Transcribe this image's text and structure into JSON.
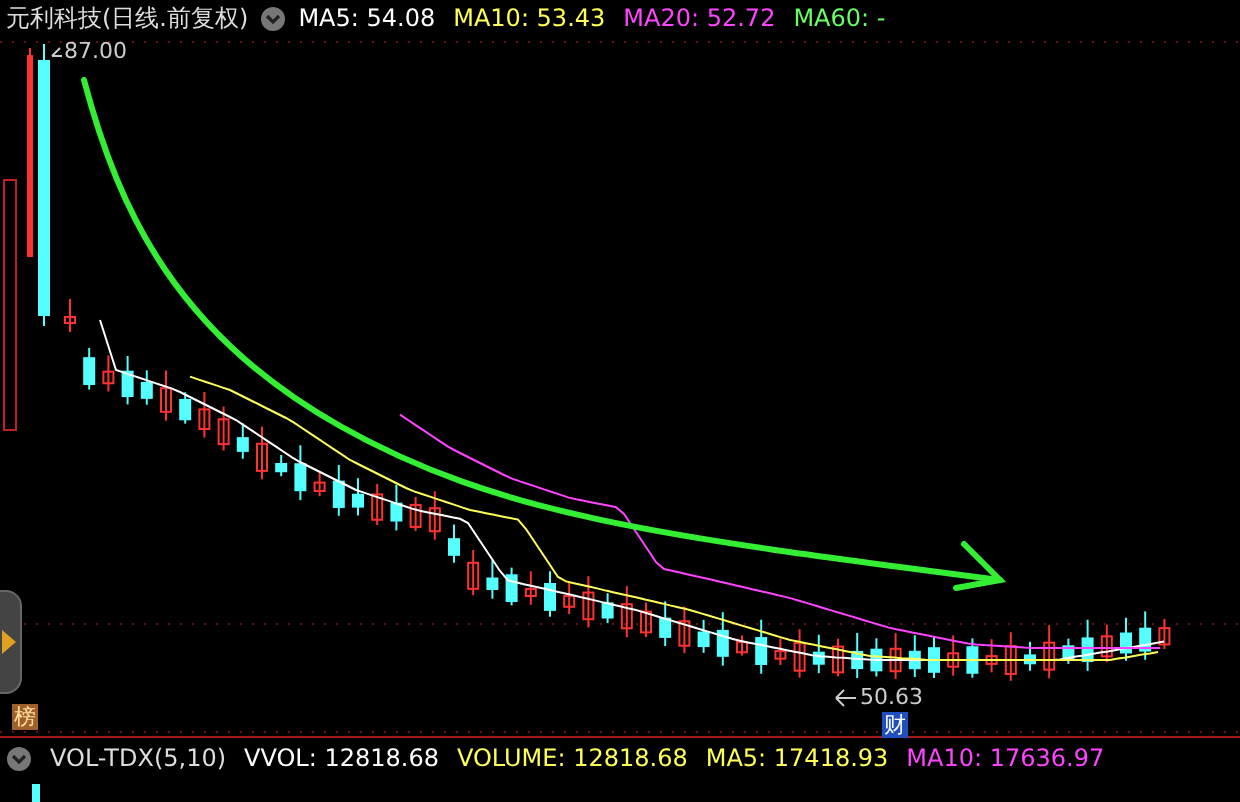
{
  "header": {
    "title": "元利科技(日线.前复权)",
    "indicators": [
      {
        "label": "MA5: 54.08",
        "color": "#ffffff"
      },
      {
        "label": "MA10: 53.43",
        "color": "#ffff55"
      },
      {
        "label": "MA20: 52.72",
        "color": "#ff44ff"
      },
      {
        "label": "MA60: -",
        "color": "#66ff66"
      }
    ]
  },
  "chart": {
    "high_label": "87.00",
    "low_label": "50.63",
    "badges": [
      {
        "text": "榜",
        "kind": "rank"
      },
      {
        "text": "财",
        "kind": "finance"
      }
    ]
  },
  "volume_header": {
    "name": "VOL-TDX(5,10)",
    "indicators": [
      {
        "label": "VVOL: 12818.68",
        "color": "#ffffff"
      },
      {
        "label": "VOLUME: 12818.68",
        "color": "#ffff55"
      },
      {
        "label": "MA5: 17418.93",
        "color": "#ffff55"
      },
      {
        "label": "MA10: 17636.97",
        "color": "#ff44ff"
      }
    ]
  }
}
